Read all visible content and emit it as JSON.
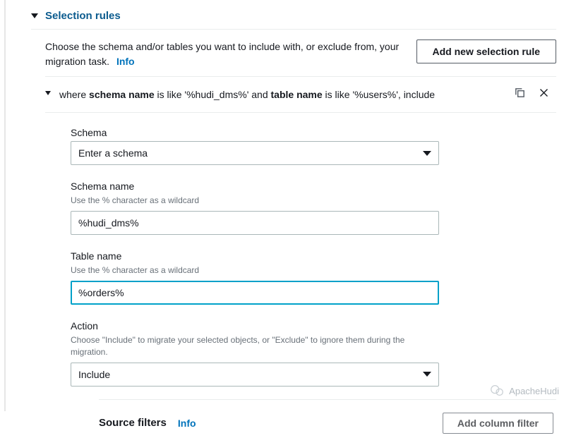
{
  "section": {
    "title": "Selection rules"
  },
  "intro": {
    "text": "Choose the schema and/or tables you want to include with, or exclude from, your migration task.",
    "info": "Info",
    "button": "Add new selection rule"
  },
  "rule": {
    "w": "where ",
    "sn_lbl": "schema name",
    "sn_mid": " is like '%hudi_dms%' and ",
    "tn_lbl": "table name",
    "tn_mid": " is like '%users%', include"
  },
  "schema": {
    "label": "Schema",
    "placeholder": "Enter a schema"
  },
  "schema_name": {
    "label": "Schema name",
    "hint": "Use the % character as a wildcard",
    "value": "%hudi_dms%"
  },
  "table_name": {
    "label": "Table name",
    "hint": "Use the % character as a wildcard",
    "value": "%orders%"
  },
  "action": {
    "label": "Action",
    "hint": "Choose \"Include\" to migrate your selected objects, or \"Exclude\" to ignore them during the migration.",
    "value": "Include"
  },
  "source_filters": {
    "title": "Source filters",
    "info": "Info",
    "button": "Add column filter"
  },
  "watermark": {
    "text": "ApacheHudi"
  }
}
